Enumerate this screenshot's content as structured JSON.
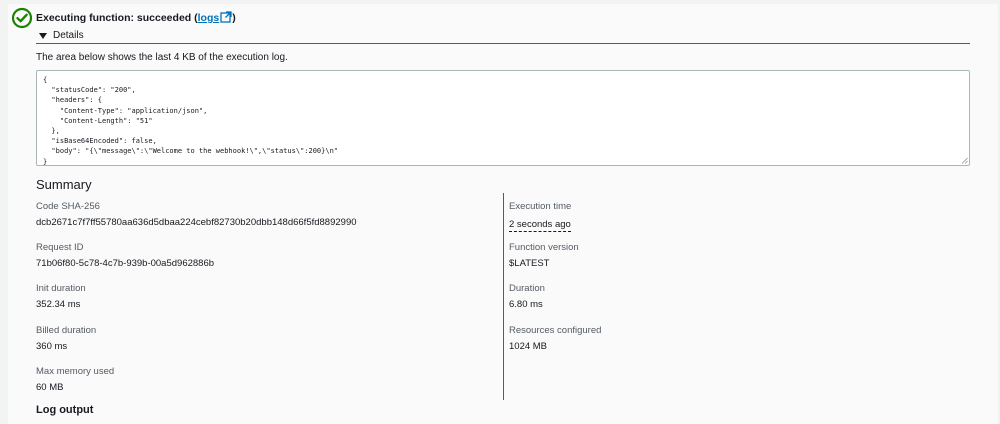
{
  "status": {
    "prefix": "Executing function: succeeded (",
    "link": "logs",
    "suffix": ")",
    "icon": "check-circle-icon",
    "color": "#1d8102"
  },
  "details": {
    "label": "Details",
    "description": "The area below shows the last 4 KB of the execution log."
  },
  "execution_result": "{\n  \"statusCode\": \"200\",\n  \"headers\": {\n    \"Content-Type\": \"application/json\",\n    \"Content-Length\": \"51\"\n  },\n  \"isBase64Encoded\": false,\n  \"body\": \"{\\\"message\\\":\\\"Welcome to the webhook!\\\",\\\"status\\\":200}\\n\"\n}",
  "summary": {
    "title": "Summary",
    "left": [
      {
        "label": "Code SHA-256",
        "value": "dcb2671c7f7ff55780aa636d5dbaa224cebf82730b20dbb148d66f5fd8892990"
      },
      {
        "label": "Request ID",
        "value": "71b06f80-5c78-4c7b-939b-00a5d962886b"
      },
      {
        "label": "Init duration",
        "value": "352.34 ms"
      },
      {
        "label": "Billed duration",
        "value": "360 ms"
      },
      {
        "label": "Max memory used",
        "value": "60 MB"
      }
    ],
    "right": [
      {
        "label": "Execution time",
        "value": "2 seconds ago"
      },
      {
        "label": "Function version",
        "value": "$LATEST"
      },
      {
        "label": "Duration",
        "value": "6.80 ms"
      },
      {
        "label": "Resources configured",
        "value": "1024 MB"
      }
    ]
  },
  "log_output": {
    "title": "Log output"
  }
}
